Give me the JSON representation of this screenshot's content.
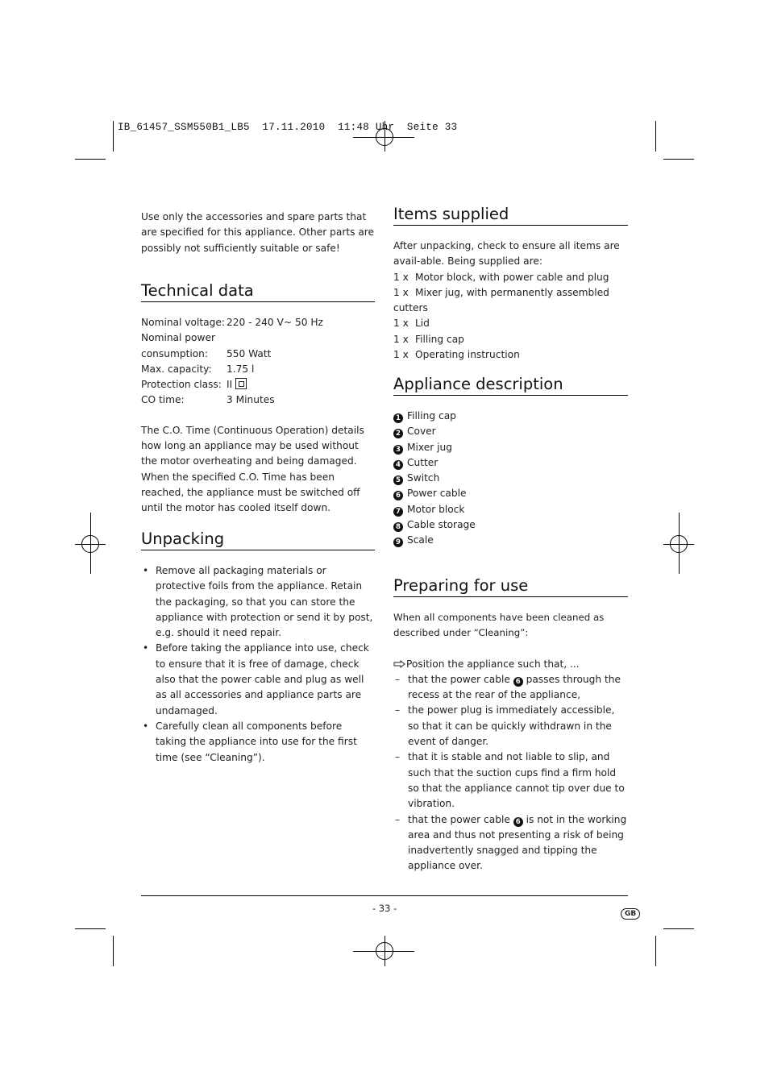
{
  "print_header": {
    "slug": "IB_61457_SSM550B1_LB5",
    "date": "17.11.2010",
    "time": "11:48 Uhr",
    "page_label": "Seite 33"
  },
  "intro": "Use only the accessories and spare parts that are specified for this appliance. Other parts are possibly not sufficiently suitable or safe!",
  "technical_data": {
    "title": "Technical data",
    "rows": [
      {
        "key": "Nominal voltage:",
        "value": "220 - 240 V~ 50 Hz"
      },
      {
        "key": "Nominal power",
        "value": ""
      },
      {
        "key": "consumption:",
        "value": "550 Watt"
      },
      {
        "key": "Max. capacity:",
        "value": "1.75 l"
      },
      {
        "key": "Protection class:",
        "value": "II"
      },
      {
        "key": "CO time:",
        "value": "3 Minutes"
      }
    ],
    "protection_icon": "double-insulation-icon",
    "note": "The C.O. Time (Continuous Operation) details how long an appliance may be used without the motor overheating and being damaged. When the specified C.O. Time has been reached, the appliance must be switched off until the motor has cooled itself down."
  },
  "unpacking": {
    "title": "Unpacking",
    "bullet": "•",
    "items": [
      "Remove all packaging materials or protective foils from the appliance. Retain the packaging, so that you can store the appliance with protection or send it by post, e.g. should it need repair.",
      "Before taking the appliance into use, check to ensure that it is free of damage, check also that the power cable and plug as well as all accessories and appliance parts are undamaged.",
      "Carefully clean all components before taking the appliance into use for the first time (see “Cleaning”)."
    ]
  },
  "items_supplied": {
    "title": "Items supplied",
    "intro": "After unpacking, check to ensure all items are avail-able. Being supplied are:",
    "items": [
      {
        "qty": "1 x",
        "label": "Motor block, with power cable and plug"
      },
      {
        "qty": "1 x",
        "label": "Mixer jug, with permanently assembled cutters"
      },
      {
        "qty": "1 x",
        "label": "Lid"
      },
      {
        "qty": "1 x",
        "label": "Filling cap"
      },
      {
        "qty": "1 x",
        "label": "Operating instruction"
      }
    ]
  },
  "appliance_description": {
    "title": "Appliance description",
    "items": [
      {
        "num": "1",
        "label": "Filling cap"
      },
      {
        "num": "2",
        "label": "Cover"
      },
      {
        "num": "3",
        "label": "Mixer jug"
      },
      {
        "num": "4",
        "label": "Cutter"
      },
      {
        "num": "5",
        "label": "Switch"
      },
      {
        "num": "6",
        "label": "Power cable"
      },
      {
        "num": "7",
        "label": "Motor block"
      },
      {
        "num": "8",
        "label": "Cable storage"
      },
      {
        "num": "9",
        "label": "Scale"
      }
    ]
  },
  "preparing": {
    "title": "Preparing for use",
    "intro": "When all components have been cleaned as described under “Cleaning”:",
    "action_icon": "arrow-right-icon",
    "action": "Position the appliance such that, ...",
    "dash": "–",
    "items": [
      {
        "before": "that the power cable",
        "ref": "6",
        "after": "passes through the recess at the rear of the appliance,"
      },
      {
        "before": "the power plug is immediately accessible, so that it can be quickly withdrawn in the event of danger.",
        "ref": "",
        "after": ""
      },
      {
        "before": "that it is stable and not liable to slip, and such that the suction cups find a firm hold so that the appliance cannot tip over due to vibration.",
        "ref": "",
        "after": ""
      },
      {
        "before": "that the power cable",
        "ref": "6",
        "after": "is not in the working area and thus not presenting a risk of being inadvertently snagged and tipping the appliance over."
      }
    ]
  },
  "footer": {
    "page_number": "- 33 -",
    "country_badge": "GB"
  }
}
